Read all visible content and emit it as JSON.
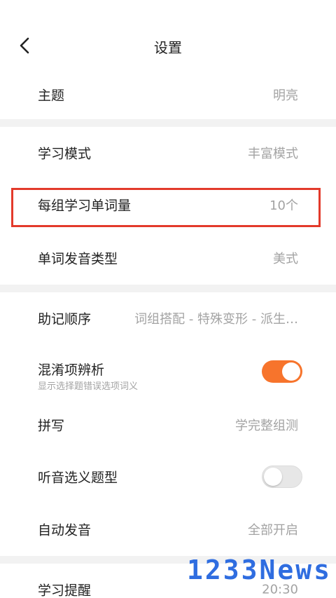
{
  "header": {
    "title": "设置",
    "back_icon": "chevron-left-icon"
  },
  "rows": {
    "theme": {
      "label": "主题",
      "value": "明亮"
    },
    "study_mode": {
      "label": "学习模式",
      "value": "丰富模式"
    },
    "words_per_group": {
      "label": "每组学习单词量",
      "value": "10个"
    },
    "pronunciation": {
      "label": "单词发音类型",
      "value": "美式"
    },
    "mnemonic_order": {
      "label": "助记顺序",
      "value": "词组搭配 - 特殊变形 - 派生…"
    },
    "confusion": {
      "label": "混淆项辨析",
      "sub": "显示选择题错误选项词义",
      "toggle": "on"
    },
    "spelling": {
      "label": "拼写",
      "value": "学完整组测"
    },
    "listening": {
      "label": "听音选义题型",
      "toggle": "off"
    },
    "auto_pronounce": {
      "label": "自动发音",
      "value": "全部开启"
    },
    "reminder": {
      "label": "学习提醒",
      "value": "20:30"
    }
  },
  "colors": {
    "accent": "#f7742c",
    "highlight_border": "#e33a2b",
    "watermark": "#2f6de0"
  },
  "watermark": "1233News"
}
